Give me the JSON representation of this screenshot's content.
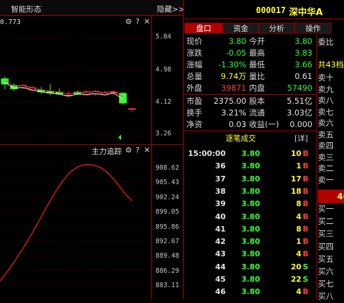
{
  "top_bar": {
    "title": "智能形态",
    "hide": "隐藏>>"
  },
  "stock": {
    "code": "000017",
    "name": "深中华A"
  },
  "tabs": [
    "盘口",
    "资金",
    "分析",
    "操作"
  ],
  "kline": {
    "corner_value": "0.773",
    "price_axis": [
      "5.84",
      "4.98",
      "4.12",
      "3.26"
    ],
    "candles": [
      {
        "o": 4.74,
        "c": 4.6,
        "h": 4.8,
        "l": 4.46
      },
      {
        "o": 4.56,
        "c": 4.47,
        "h": 4.62,
        "l": 4.41
      },
      {
        "o": 4.5,
        "c": 4.56,
        "h": 4.6,
        "l": 4.46
      },
      {
        "o": 4.44,
        "c": 4.5,
        "h": 4.55,
        "l": 4.38
      },
      {
        "o": 4.44,
        "c": 4.39,
        "h": 4.52,
        "l": 4.34
      },
      {
        "o": 4.4,
        "c": 4.36,
        "h": 4.6,
        "l": 4.3
      },
      {
        "o": 4.38,
        "c": 4.33,
        "h": 4.48,
        "l": 4.3
      },
      {
        "o": 4.3,
        "c": 4.3,
        "h": 4.4,
        "l": 4.26
      },
      {
        "o": 4.38,
        "c": 4.33,
        "h": 4.42,
        "l": 4.3
      },
      {
        "o": 4.31,
        "c": 4.39,
        "h": 4.43,
        "l": 4.28
      },
      {
        "o": 4.33,
        "c": 4.4,
        "h": 4.44,
        "l": 4.29
      },
      {
        "o": 4.31,
        "c": 4.36,
        "h": 4.42,
        "l": 4.28
      },
      {
        "o": 4.38,
        "c": 4.38,
        "h": 4.42,
        "l": 4.32
      },
      {
        "o": 4.35,
        "c": 4.09,
        "h": 4.38,
        "l": 4.05
      },
      {
        "o": 3.94,
        "c": 3.94,
        "h": 3.94,
        "l": 3.86
      }
    ]
  },
  "indicator": {
    "title": "主力追踪",
    "axis": [
      "908.62",
      "905.43",
      "902.24",
      "899.05",
      "895.86",
      "892.67",
      "889.48",
      "886.29",
      "883.11"
    ],
    "curve": [
      884.0,
      886.2,
      888.6,
      891.2,
      894.0,
      897.0,
      900.1,
      903.0,
      905.6,
      907.6,
      908.8,
      909.3,
      909.2,
      908.6,
      907.3,
      905.4,
      903.1,
      901.4
    ]
  },
  "quote": [
    {
      "l1": "现价",
      "v1": "3.80",
      "c1": "green",
      "l2": "今开",
      "v2": "3.80",
      "c2": "green"
    },
    {
      "l1": "涨跌",
      "v1": "-0.05",
      "c1": "green",
      "l2": "最高",
      "v2": "3.83",
      "c2": "green"
    },
    {
      "l1": "涨幅",
      "v1": "-1.30%",
      "c1": "green",
      "l2": "最低",
      "v2": "3.66",
      "c2": "green"
    },
    {
      "l1": "总量",
      "v1": "9.74万",
      "c1": "yellow",
      "l2": "量比",
      "v2": "0.61",
      "c2": "white"
    },
    {
      "l1": "外盘",
      "v1": "39871",
      "c1": "red",
      "l2": "内盘",
      "v2": "57490",
      "c2": "green"
    }
  ],
  "fund": [
    {
      "l1": "市盈",
      "v1": "2375.00",
      "l2": "股本",
      "v2": "5.51亿"
    },
    {
      "l1": "换手",
      "v1": "3.21%",
      "l2": "流通",
      "v2": "3.03亿"
    },
    {
      "l1": "净资",
      "v1": "0.03",
      "l2": "收益(一)",
      "v2": "0.000"
    }
  ],
  "trades_header": {
    "title": "逐笔成交",
    "detail": "[详]"
  },
  "trades": [
    {
      "time": "15:00:00",
      "price": "3.80",
      "vol": "10",
      "side": "B"
    },
    {
      "time": "36",
      "price": "3.80",
      "vol": "1",
      "side": "B"
    },
    {
      "time": "37",
      "price": "3.80",
      "vol": "17",
      "side": "B"
    },
    {
      "time": "38",
      "price": "3.80",
      "vol": "18",
      "side": "B"
    },
    {
      "time": "39",
      "price": "3.80",
      "vol": "8",
      "side": "B"
    },
    {
      "time": "40",
      "price": "3.80",
      "vol": "4",
      "side": "B"
    },
    {
      "time": "41",
      "price": "3.80",
      "vol": "8",
      "side": "B"
    },
    {
      "time": "42",
      "price": "3.80",
      "vol": "1",
      "side": "B"
    },
    {
      "time": "43",
      "price": "3.80",
      "vol": "4",
      "side": "B"
    },
    {
      "time": "44",
      "price": "3.80",
      "vol": "20",
      "side": "S"
    },
    {
      "time": "45",
      "price": "3.80",
      "vol": "22",
      "side": "S"
    },
    {
      "time": "46",
      "price": "3.80",
      "vol": "4",
      "side": "B"
    }
  ],
  "order_side": {
    "weibi": "委比",
    "header": "共43档",
    "sells": [
      "卖十",
      "卖九",
      "卖八",
      "卖七",
      "卖六",
      "卖五",
      "卖四",
      "卖三",
      "卖二",
      "卖一"
    ],
    "mid": "4(",
    "buys": [
      "买一",
      "买二",
      "买三",
      "买四",
      "买五",
      "买六",
      "买七",
      "买八"
    ]
  },
  "colors": {
    "grid": "#b00000",
    "up": "#ff3b3b",
    "down": "#33ff33",
    "accent": "#ffff33"
  }
}
